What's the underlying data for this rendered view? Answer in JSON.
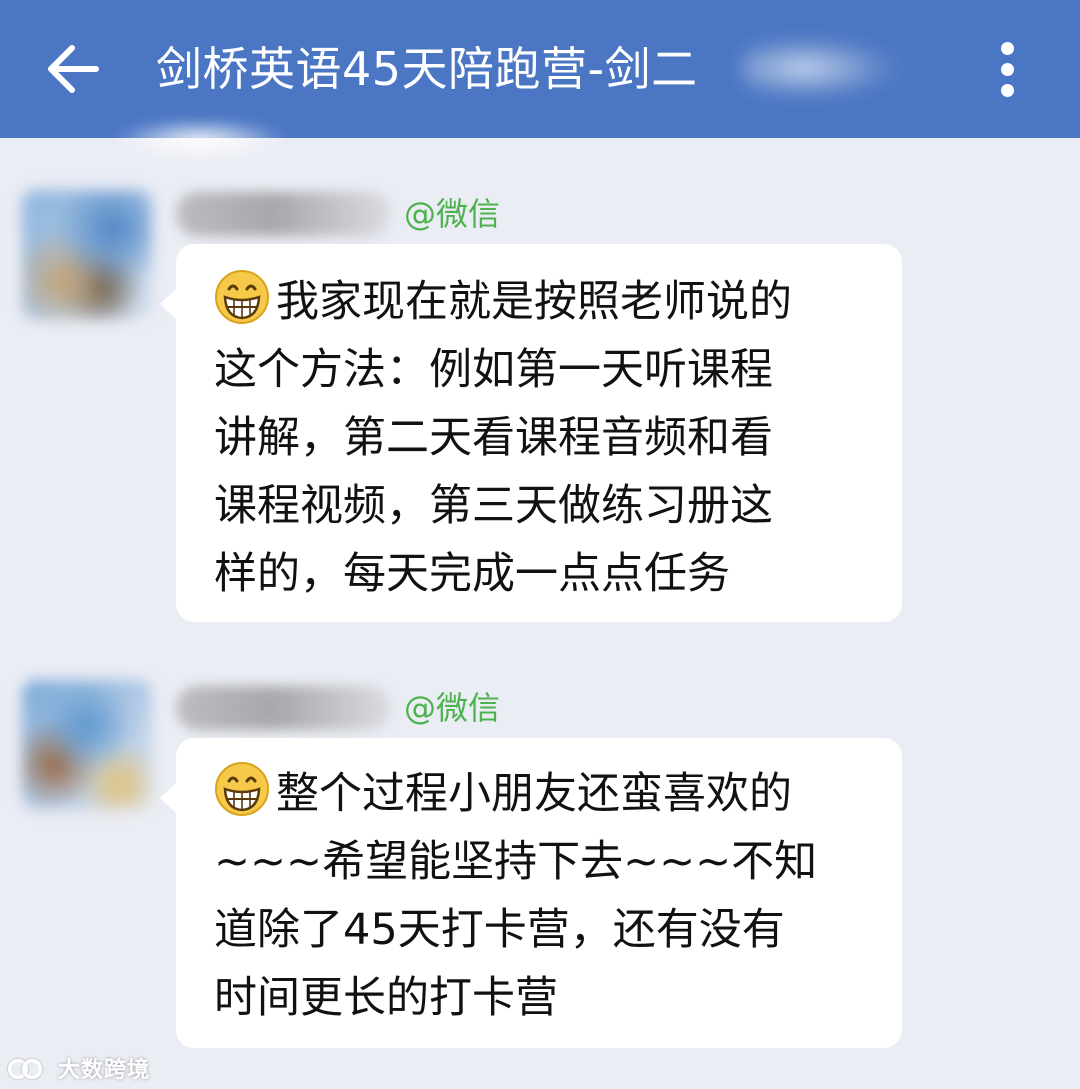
{
  "header": {
    "title": "剑桥英语45天陪跑营-剑二",
    "back_icon": "arrow-left-icon",
    "more_icon": "more-vertical-icon",
    "background": "#4a76c4"
  },
  "messages": [
    {
      "source_tag": "@微信",
      "emoji": "grinning-face-emoji",
      "lines": [
        "我家现在就是按照老师说的",
        "这个方法：例如第一天听课程",
        "讲解，第二天看课程音频和看",
        "课程视频，第三天做练习册这",
        "样的，每天完成一点点任务"
      ]
    },
    {
      "source_tag": "@微信",
      "emoji": "grinning-face-emoji",
      "lines": [
        "整个过程小朋友还蛮喜欢的",
        "~~~希望能坚持下去~~~不知",
        "道除了45天打卡营，还有没有",
        "时间更长的打卡营"
      ]
    }
  ],
  "watermark": {
    "text": "大数跨境"
  },
  "colors": {
    "source_tag": "#4db24d",
    "bubble": "#ffffff",
    "chat_background": "#ebedf5"
  }
}
